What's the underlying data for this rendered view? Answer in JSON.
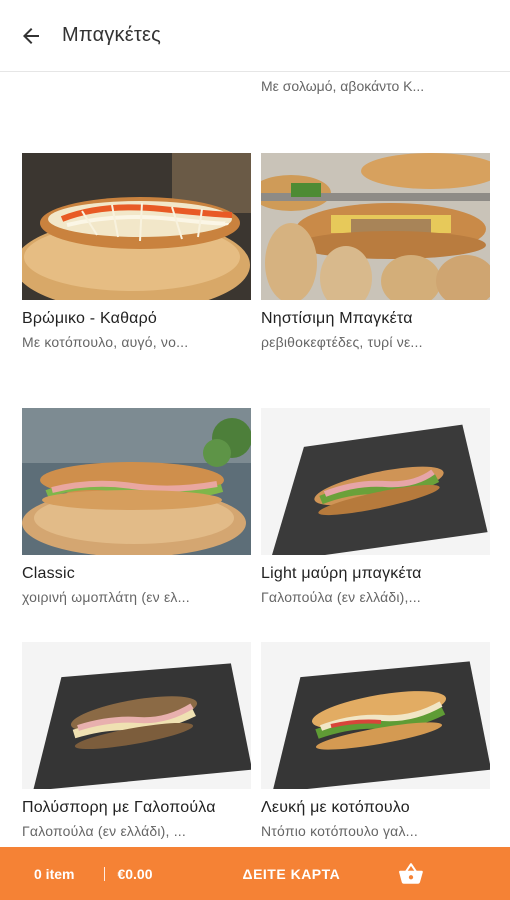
{
  "header": {
    "title": "Μπαγκέτες",
    "back_icon": "arrow-left-icon"
  },
  "partial_item": {
    "description": "Με σολωμό, αβοκάντο Κ..."
  },
  "products": [
    {
      "name": "Βρώμικο - Καθαρό",
      "description": "Με κοτόπουλο, αυγό, νο..."
    },
    {
      "name": "Νηστίσιμη Μπαγκέτα",
      "description": "ρεβιθοκεφτέδες, τυρί νε..."
    },
    {
      "name": "Classic",
      "description": "χοιρινή ωμοπλάτη (εν ελ..."
    },
    {
      "name": "Light μαύρη μπαγκέτα",
      "description": "Γαλοπούλα (εν ελλάδι),..."
    },
    {
      "name": "Πολύσπορη με Γαλοπούλα",
      "description": "Γαλοπούλα (εν ελλάδι), ..."
    },
    {
      "name": "Λευκή με κοτόπουλο",
      "description": "Ντόπιο κοτόπουλο γαλ..."
    }
  ],
  "cart": {
    "count_label": "0 item",
    "total": "€0.00",
    "cta_label": "ΔΕΙΤΕ ΚΑΡΤΑ",
    "basket_icon": "basket-icon",
    "accent_color": "#f58235"
  }
}
